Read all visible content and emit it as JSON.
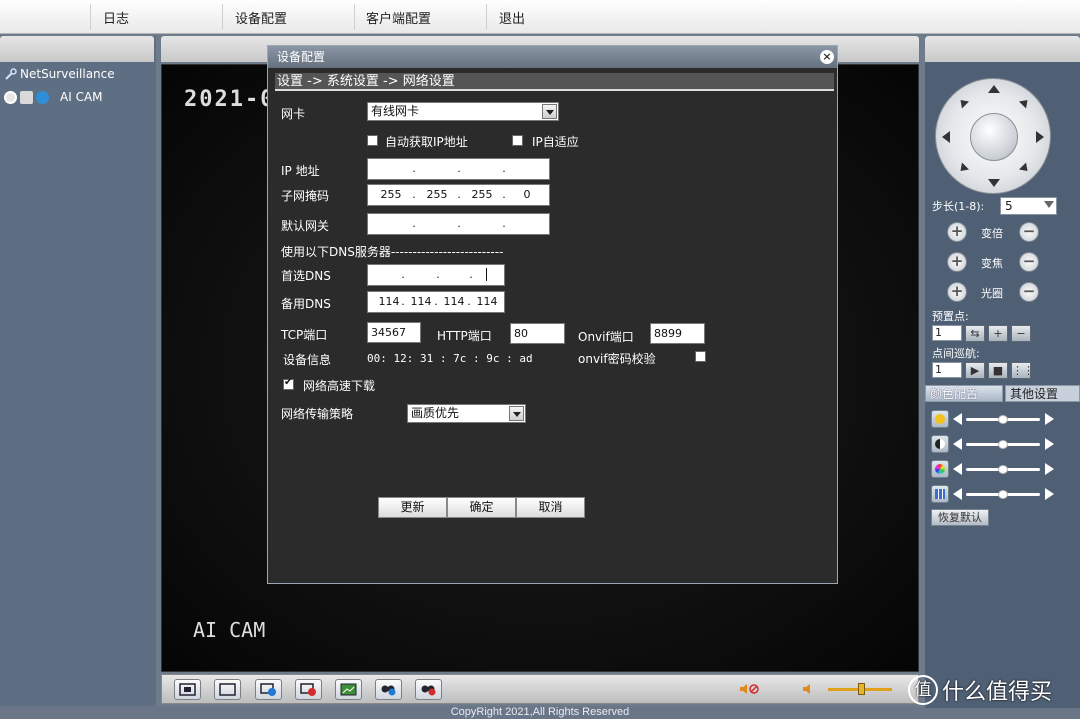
{
  "menu": {
    "items": [
      "日志",
      "设备配置",
      "客户端配置",
      "退出"
    ]
  },
  "tree": {
    "root_label": "NetSurveillance",
    "camera_label": "AI CAM"
  },
  "video": {
    "osd_time": "2021-0",
    "osd_name": "AI CAM"
  },
  "dialog": {
    "title": "设备配置",
    "close_glyph": "×",
    "breadcrumb": "设置 -> 系统设置 -> 网络设置",
    "nic_label": "网卡",
    "nic_value": "有线网卡",
    "dhcp_label": "自动获取IP地址",
    "ip_adaptive_label": "IP自适应",
    "ip_label": "IP 地址",
    "ip_value": [
      "",
      "",
      "",
      ""
    ],
    "mask_label": "子网掩码",
    "mask_value": [
      "255",
      "255",
      "255",
      "0"
    ],
    "gateway_label": "默认网关",
    "gateway_value": [
      "",
      "",
      "",
      ""
    ],
    "dns_section_label": "使用以下DNS服务器--------------------------",
    "dns1_label": "首选DNS",
    "dns1_value": [
      "",
      "",
      "",
      ""
    ],
    "dns2_label": "备用DNS",
    "dns2_value": [
      "114",
      "114",
      "114",
      "114"
    ],
    "tcp_label": "TCP端口",
    "tcp_value": "34567",
    "http_label": "HTTP端口",
    "http_value": "80",
    "onvif_label": "Onvif端口",
    "onvif_value": "8899",
    "device_info_label": "设备信息",
    "mac_value": "00: 12: 31 : 7c : 9c : ad",
    "onvif_auth_label": "onvif密码校验",
    "high_speed_label": "网络高速下载",
    "high_speed_checked": true,
    "dhcp_checked": false,
    "ip_adaptive_checked": false,
    "onvif_auth_checked": false,
    "strategy_label": "网络传输策略",
    "strategy_value": "画质优先",
    "buttons": {
      "refresh": "更新",
      "ok": "确定",
      "cancel": "取消"
    }
  },
  "ptz": {
    "step_label": "步长(1-8):",
    "step_value": "5",
    "zoom_label": "变倍",
    "focus_label": "变焦",
    "iris_label": "光圈",
    "preset_label": "预置点:",
    "preset_value": "1",
    "cruise_label": "点间巡航:",
    "cruise_value": "1"
  },
  "color_panel": {
    "tab_color": "颜色配置",
    "tab_other": "其他设置",
    "restore_label": "恢复默认",
    "icons": [
      "brightness-icon",
      "contrast-icon",
      "saturation-icon",
      "hue-icon"
    ]
  },
  "footer": {
    "copyright": "CopyRight 2021,All Rights Reserved"
  },
  "watermark": {
    "glyph": "值",
    "text": "什么值得买"
  }
}
